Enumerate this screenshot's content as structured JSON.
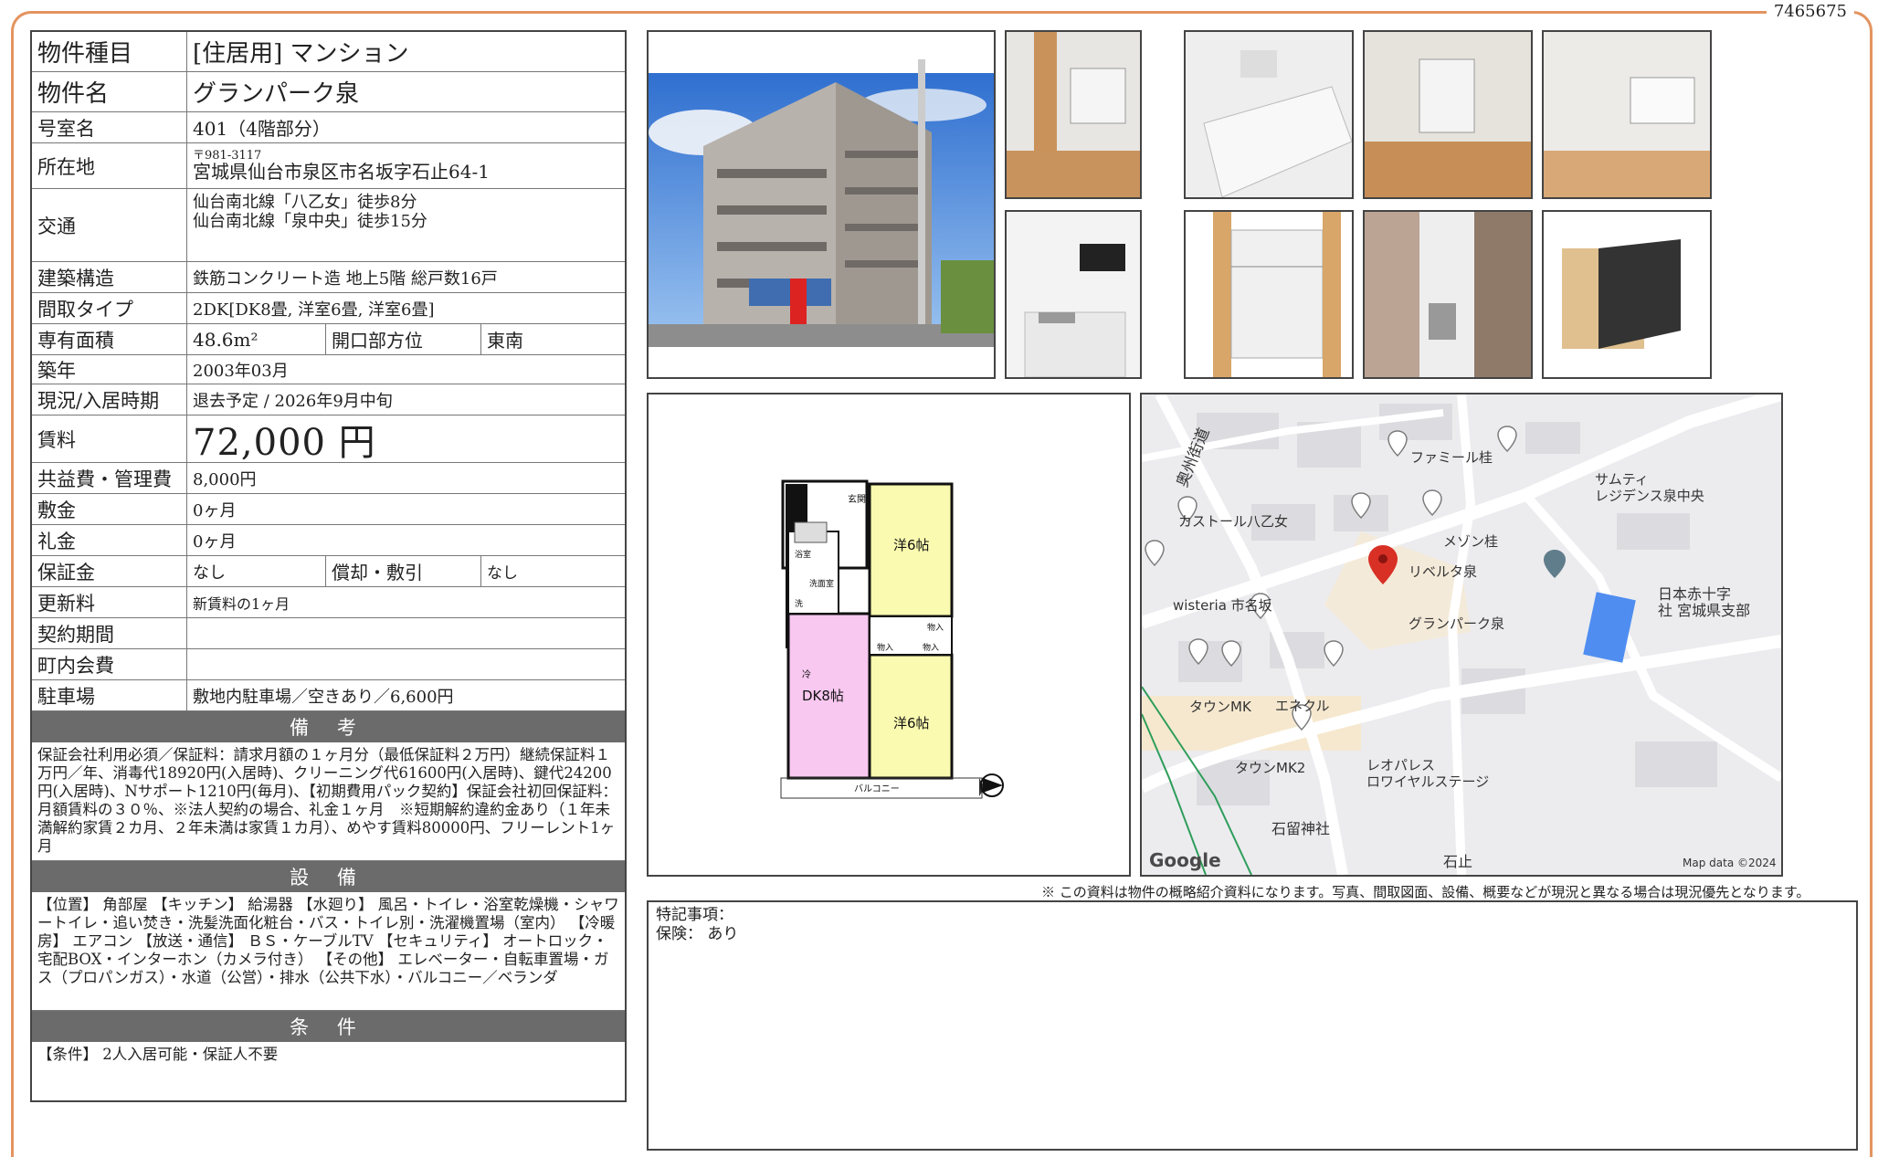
{
  "doc_id": "7465675",
  "rows": {
    "type_label": "物件種目",
    "type_value": "[住居用]  マンション",
    "name_label": "物件名",
    "name_value": "グランパーク泉",
    "room_label": "号室名",
    "room_value": "401（4階部分）",
    "addr_label": "所在地",
    "addr_zip": "〒981-3117",
    "addr_value": "宮城県仙台市泉区市名坂字石止64-1",
    "traffic_label": "交通",
    "traffic_1": "仙台南北線「八乙女」徒歩8分",
    "traffic_2": "仙台南北線「泉中央」徒歩15分",
    "structure_label": "建築構造",
    "structure_value": "鉄筋コンクリート造  地上5階  総戸数16戸",
    "layout_label": "間取タイプ",
    "layout_value": "2DK[DK8畳, 洋室6畳, 洋室6畳]",
    "area_label": "専有面積",
    "area_value": "48.6m²",
    "direction_label": "開口部方位",
    "direction_value": "東南",
    "built_label": "築年",
    "built_value": "2003年03月",
    "status_label": "現況/入居時期",
    "status_value": "退去予定  /  2026年9月中旬",
    "rent_label": "賃料",
    "rent_value": "72,000 円",
    "fee_label": "共益費・管理費",
    "fee_value": "8,000円",
    "deposit_label": "敷金",
    "deposit_value": "0ヶ月",
    "keymoney_label": "礼金",
    "keymoney_value": "0ヶ月",
    "guarantee_label": "保証金",
    "guarantee_value": "なし",
    "amort_label": "償却・敷引",
    "amort_value": "なし",
    "renewal_label": "更新料",
    "renewal_value": "新賃料の1ヶ月",
    "contract_label": "契約期間",
    "contract_value": "",
    "town_label": "町内会費",
    "town_value": "",
    "parking_label": "駐車場",
    "parking_value": "敷地内駐車場／空きあり／6,600円"
  },
  "remarks_head": "備 考",
  "remarks_text": "保証会社利用必須／保証料：請求月額の１ヶ月分（最低保証料２万円）継続保証料１万円／年、消毒代18920円(入居時)、クリーニング代61600円(入居時)、鍵代24200円(入居時)、Nサポート1210円(毎月)、【初期費用パック契約】保証会社初回保証料：月額賃料の３０％、※法人契約の場合、礼金１ヶ月　※短期解約違約金あり（１年未満解約家賃２カ月、２年未満は家賃１カ月）、めやす賃料80000円、フリーレント1ヶ月",
  "equipment_head": "設 備",
  "equipment_text": "【位置】 角部屋 【キッチン】 給湯器 【水廻り】 風呂・トイレ・浴室乾燥機・シャワートイレ・追い焚き・洗髪洗面化粧台・バス・トイレ別・洗濯機置場（室内） 【冷暖房】 エアコン 【放送・通信】 ＢＳ・ケーブルTV 【セキュリティ】 オートロック・宅配BOX・インターホン（カメラ付き） 【その他】 エレベーター・自転車置場・ガス（プロパンガス）・水道（公営）・排水（公共下水）・バルコニー／ベランダ",
  "conditions_head": "条 件",
  "conditions_text": "【条件】 2人入居可能・保証人不要",
  "floorplan": {
    "room1": "洋6帖",
    "room2": "洋6帖",
    "dk": "DK8帖",
    "genkan": "玄関",
    "bath": "浴室",
    "wash": "洗面室",
    "storage1": "物入",
    "storage2": "物入",
    "storage3": "物入",
    "balcony": "バルコニー",
    "fridge": "冷",
    "wm": "洗"
  },
  "map": {
    "road": "奥州街道",
    "labels": [
      "ファミール桂",
      "サムティ",
      "レジデンス泉中央",
      "カストール八乙女",
      "メゾン桂",
      "リベルタ泉",
      "wisteria 市名坂",
      "グランパーク泉",
      "日本赤十字",
      "社 宮城県支部",
      "タウンMK",
      "エネクル",
      "タウンMK2",
      "レオパレス",
      "ロワイヤルステージ",
      "石留神社",
      "石止"
    ],
    "google": "Google",
    "mapdata": "Map data ©2024",
    "colors": {
      "pin": "#d93025",
      "water": "#4f8ef0",
      "road": "#ffffff",
      "bg": "#ececef",
      "green": "#2e9d5a"
    }
  },
  "disclaimer": "※ この資料は物件の概略紹介資料になります。写真、間取図面、設備、概要などが現況と異なる場合は現況優先となります。",
  "special_notes_title": "特記事項：",
  "special_notes_line": "保険：  あり"
}
